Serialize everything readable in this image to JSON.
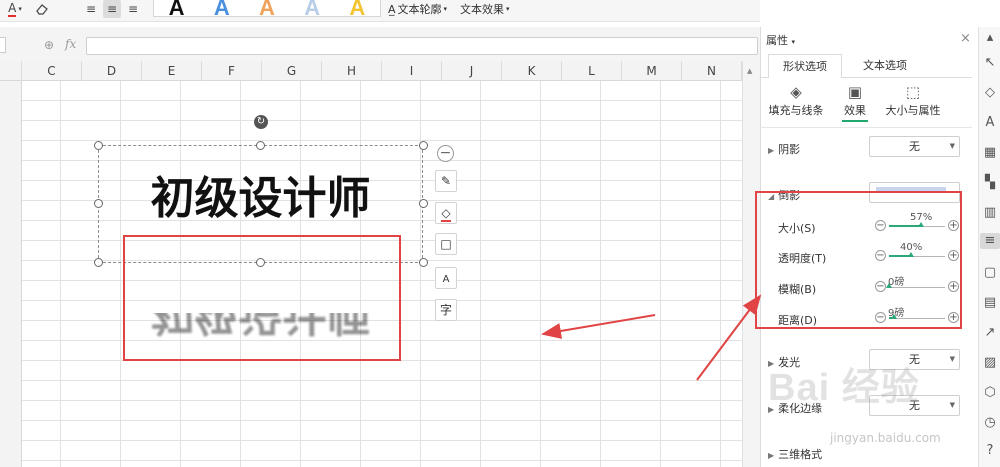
{
  "ribbon": {
    "font_color_icon": "A",
    "eraser_icon": "eraser",
    "align_icons": [
      "≡",
      "≡",
      "≡"
    ],
    "text_styles": [
      "A",
      "A",
      "A",
      "A",
      "A"
    ],
    "text_outline_label": "文本轮廓",
    "text_effect_label": "文本效果"
  },
  "formula_bar": {
    "fx_label": "fx",
    "value": ""
  },
  "columns": [
    "C",
    "D",
    "E",
    "F",
    "G",
    "H",
    "I",
    "J",
    "K",
    "L",
    "M",
    "N"
  ],
  "shape": {
    "text": "初级设计师",
    "reflection_text": "初级设计师"
  },
  "float_tools": [
    "−",
    "✎",
    "◇",
    "□",
    "A",
    "字"
  ],
  "pane": {
    "title": "属性",
    "tabs": [
      "形状选项",
      "文本选项"
    ],
    "subtabs": [
      "填充与线条",
      "效果",
      "大小与属性"
    ],
    "shadow": {
      "label": "阴影",
      "value": "无"
    },
    "reflection": {
      "label": "倒影",
      "size_label": "大小(S)",
      "size_value": "57%",
      "size_level": 0.57,
      "transparency_label": "透明度(T)",
      "transparency_value": "40%",
      "transparency_level": 0.4,
      "blur_label": "模糊(B)",
      "blur_value": "0磅",
      "blur_level": 0.0,
      "distance_label": "距离(D)",
      "distance_value": "9磅",
      "distance_level": 0.09
    },
    "glow": {
      "label": "发光",
      "value": "无"
    },
    "soft_edge": {
      "label": "柔化边缘",
      "value": "无"
    },
    "three_d_format": {
      "label": "三维格式"
    }
  },
  "watermark": {
    "text": "Bai 经验",
    "url": "jingyan.baidu.com"
  },
  "colors": {
    "accent": "#2ba778",
    "annotation": "#e04444"
  }
}
